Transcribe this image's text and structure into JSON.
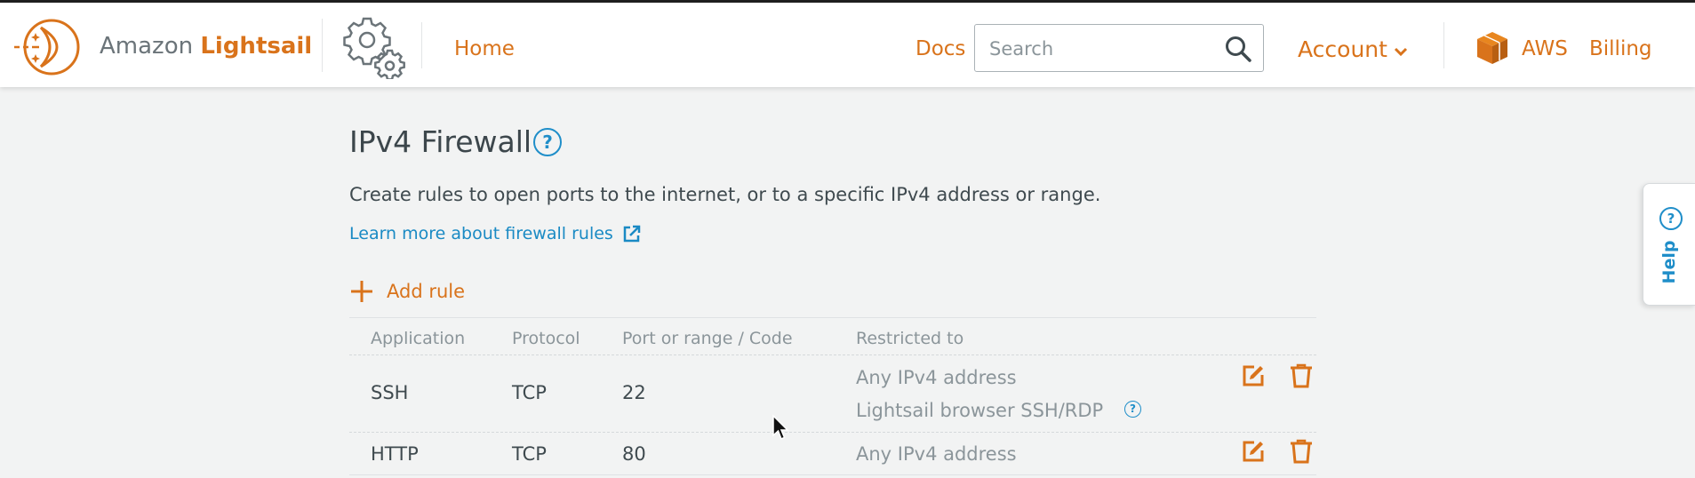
{
  "brand": {
    "name_part1": "Amazon ",
    "name_part2": "Lightsail"
  },
  "nav": {
    "home": "Home",
    "docs": "Docs",
    "search_placeholder": "Search",
    "account": "Account",
    "aws": "AWS",
    "billing": "Billing"
  },
  "firewall": {
    "title": "IPv4 Firewall",
    "help_glyph": "?",
    "description": "Create rules to open ports to the internet, or to a specific IPv4 address or range.",
    "learn_more": "Learn more about firewall rules",
    "add_rule": "Add rule",
    "columns": [
      "Application",
      "Protocol",
      "Port or range / Code",
      "Restricted to"
    ],
    "rules": [
      {
        "application": "SSH",
        "protocol": "TCP",
        "port": "22",
        "restricted": [
          "Any IPv4 address",
          "Lightsail browser SSH/RDP"
        ]
      },
      {
        "application": "HTTP",
        "protocol": "TCP",
        "port": "80",
        "restricted": [
          "Any IPv4 address"
        ]
      }
    ]
  },
  "help_tab": {
    "label": "Help",
    "glyph": "?"
  },
  "colors": {
    "accent": "#d9731b",
    "link": "#1a8ac4",
    "help_blue": "#1f8ec9"
  },
  "icons": [
    "lightsail-logo-icon",
    "settings-gears-icon",
    "search-icon",
    "chevron-down-icon",
    "aws-cube-icon",
    "external-link-icon",
    "plus-icon",
    "edit-icon",
    "trash-icon",
    "help-icon",
    "mouse-cursor-icon"
  ]
}
